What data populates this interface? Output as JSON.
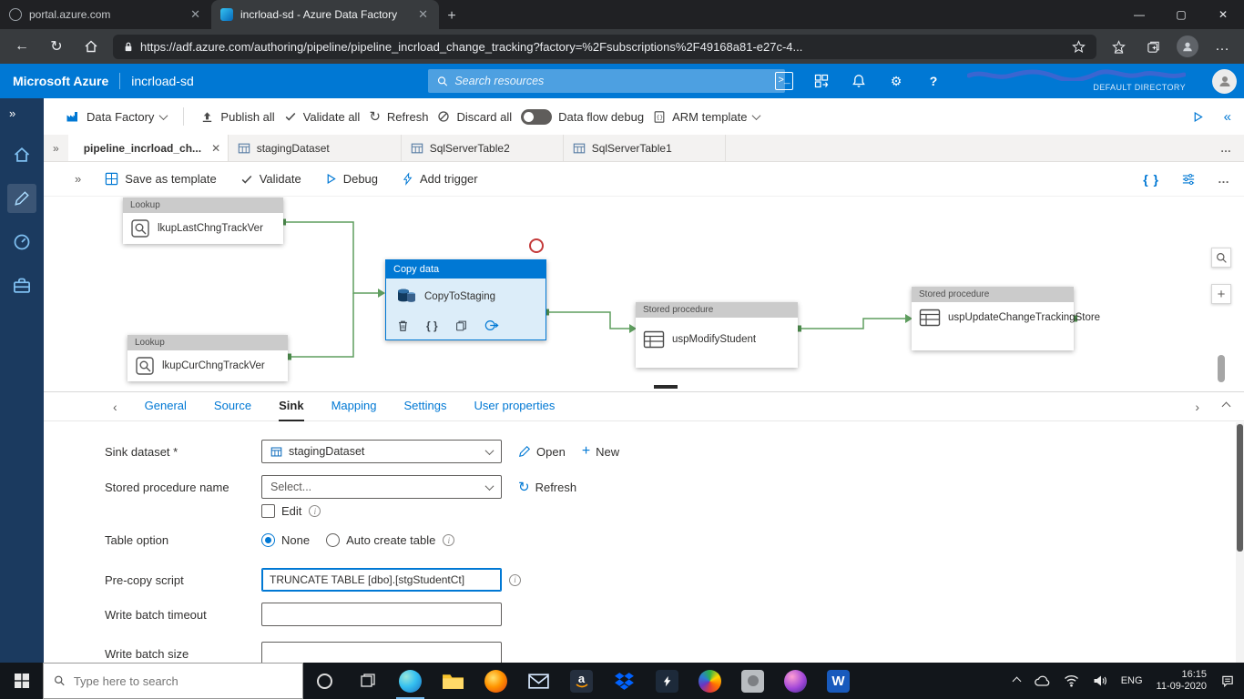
{
  "colors": {
    "accent": "#0078d4",
    "connector": "#5f9e5f",
    "error": "#c43b3b",
    "sidebar": "#1b3a5f"
  },
  "icons": {
    "search": "magnifier glyph",
    "lock": "padlock",
    "bell": "notification bell",
    "factory": "factory building",
    "lightning": "trigger bolt",
    "braces": "{ }",
    "windows": "start logo",
    "wifi": "network arcs",
    "volume": "speaker",
    "cloud": "onedrive cloud"
  },
  "browser": {
    "tabs": [
      {
        "title": "portal.azure.com"
      },
      {
        "title": "incrload-sd - Azure Data Factory"
      }
    ],
    "url": "https://adf.azure.com/authoring/pipeline/pipeline_incrload_change_tracking?factory=%2Fsubscriptions%2F49168a81-e27c-4..."
  },
  "azure_bar": {
    "brand": "Microsoft Azure",
    "app_name": "incrload-sd",
    "search_placeholder": "Search resources",
    "directory_label": "DEFAULT DIRECTORY"
  },
  "factory_toolbar": {
    "data_factory": "Data Factory",
    "publish_all": "Publish all",
    "validate_all": "Validate all",
    "refresh": "Refresh",
    "discard_all": "Discard all",
    "data_flow_debug": "Data flow debug",
    "arm_template": "ARM template"
  },
  "doc_tabs": [
    {
      "label": "pipeline_incrload_ch...",
      "active": true
    },
    {
      "label": "stagingDataset",
      "active": false
    },
    {
      "label": "SqlServerTable2",
      "active": false
    },
    {
      "label": "SqlServerTable1",
      "active": false
    }
  ],
  "pipeline_toolbar": {
    "save_as_template": "Save as template",
    "validate": "Validate",
    "debug": "Debug",
    "add_trigger": "Add trigger"
  },
  "canvas": {
    "nodes": [
      {
        "type": "Lookup",
        "name": "lkupLastChngTrackVer"
      },
      {
        "type": "Lookup",
        "name": "lkupCurChngTrackVer"
      },
      {
        "type": "Copy data",
        "name": "CopyToStaging"
      },
      {
        "type": "Stored procedure",
        "name": "uspModifyStudent"
      },
      {
        "type": "Stored procedure",
        "name": "uspUpdateChangeTrackingStore"
      }
    ]
  },
  "config_panel": {
    "tabs": [
      {
        "label": "General",
        "active": false
      },
      {
        "label": "Source",
        "active": false
      },
      {
        "label": "Sink",
        "active": true
      },
      {
        "label": "Mapping",
        "active": false
      },
      {
        "label": "Settings",
        "active": false
      },
      {
        "label": "User properties",
        "active": false
      }
    ],
    "fields": {
      "sink_dataset_label": "Sink dataset *",
      "sink_dataset_value": "stagingDataset",
      "open_label": "Open",
      "new_label": "New",
      "stored_procedure_label": "Stored procedure name",
      "stored_procedure_value": "Select...",
      "refresh_label": "Refresh",
      "edit_label": "Edit",
      "table_option_label": "Table option",
      "table_option_none": "None",
      "table_option_auto": "Auto create table",
      "precopy_label": "Pre-copy script",
      "precopy_value": "TRUNCATE TABLE [dbo].[stgStudentCt]",
      "write_batch_timeout_label": "Write batch timeout",
      "write_batch_size_label": "Write batch size"
    }
  },
  "taskbar": {
    "search_placeholder": "Type here to search",
    "apps": [
      "edge",
      "file-explorer",
      "firefox",
      "mail",
      "amazon",
      "dropbox",
      "bolt-app",
      "colorful-app",
      "gray-app",
      "media-app",
      "word"
    ],
    "language": "ENG",
    "time": "16:15",
    "date": "11-09-2020"
  }
}
